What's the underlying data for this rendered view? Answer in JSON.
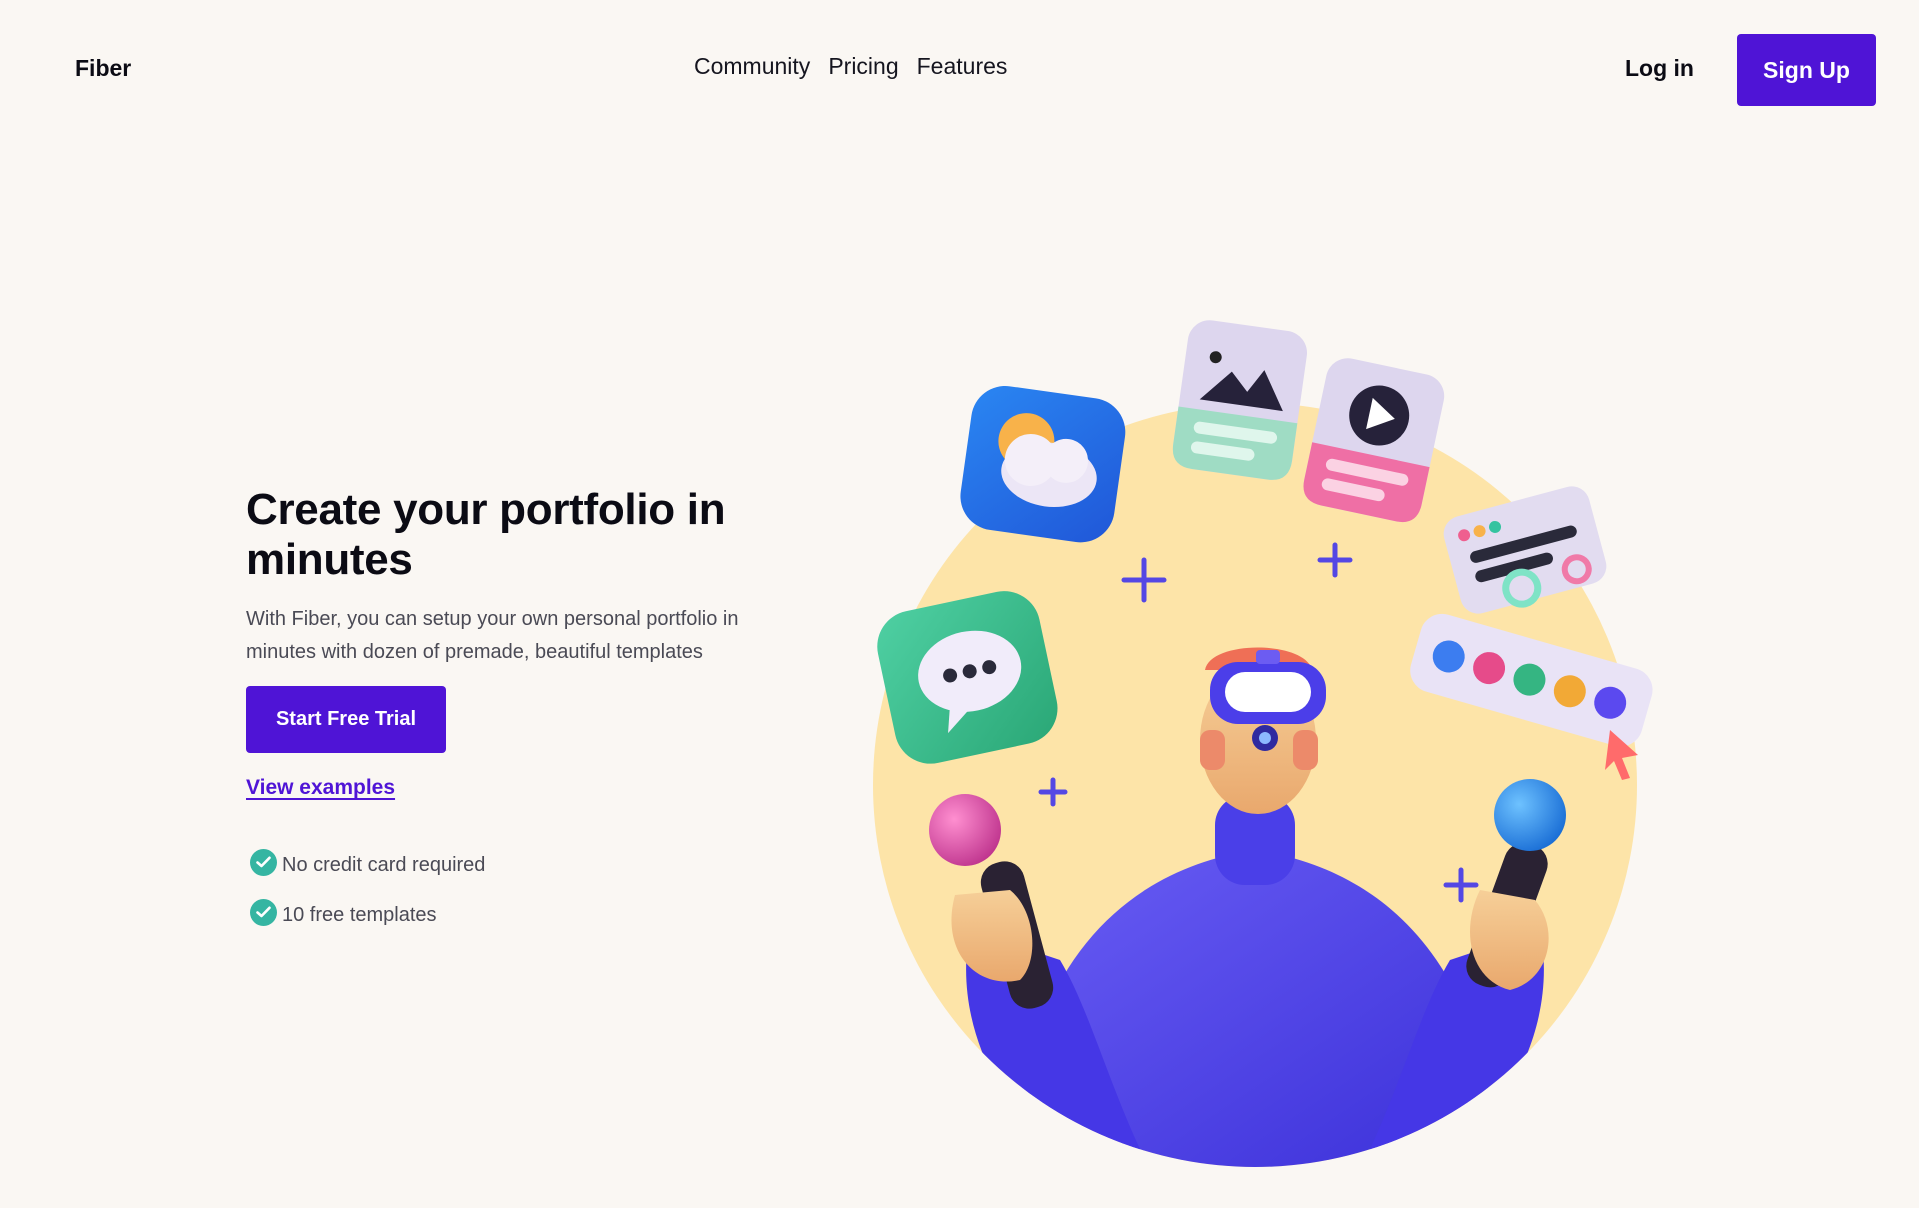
{
  "nav": {
    "brand": "Fiber",
    "links": [
      "Community",
      "Pricing",
      "Features"
    ],
    "login": "Log in",
    "signup": "Sign Up"
  },
  "hero": {
    "title_line1": "Create your portfolio in",
    "title_line2": "minutes",
    "subtitle_line1": "With Fiber, you can setup your own personal portfolio in",
    "subtitle_line2": "minutes with dozen of premade, beautiful templates",
    "cta": "Start Free Trial",
    "secondary_link": "View examples",
    "features": [
      "No credit card required",
      "10 free templates"
    ]
  },
  "colors": {
    "background": "#faf7f3",
    "accent": "#4f14d6",
    "check": "#35b5a2",
    "circle": "#fde4a8",
    "shirt": "#4a3fe8"
  },
  "icons": {
    "check": "check-circle-icon",
    "weather": "weather-cloud-icon",
    "image": "image-card-icon",
    "video": "video-play-icon",
    "chat": "chat-bubble-icon",
    "text_card": "text-card-icon",
    "color_palette": "color-palette-icon",
    "cursor": "cursor-arrow-icon"
  }
}
